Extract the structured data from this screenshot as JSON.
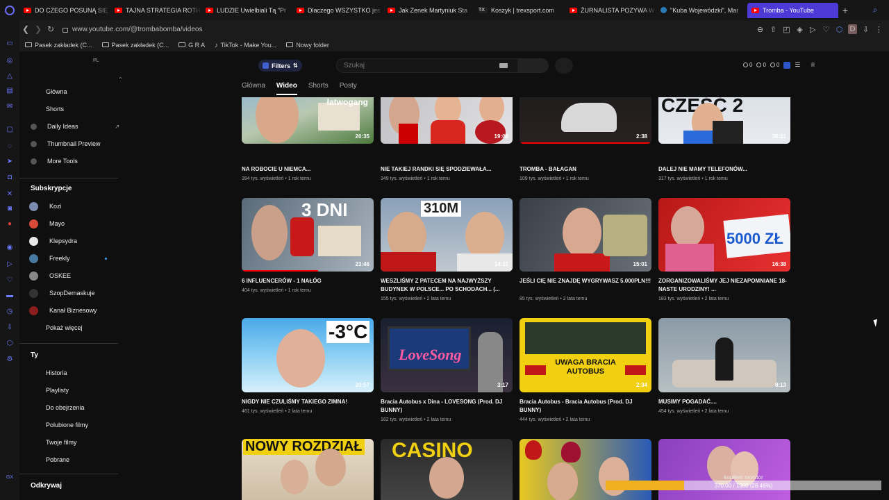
{
  "browser": {
    "tabs": [
      {
        "label": "DO CZEGO POSUNĄ SIĘ",
        "icon": "youtube-icon"
      },
      {
        "label": "TAJNA STRATEGIA ROTH",
        "icon": "youtube-icon"
      },
      {
        "label": "LUDZIE Uwielbiali Tą \"Pr",
        "icon": "youtube-icon"
      },
      {
        "label": "Dlaczego WSZYSTKO jes",
        "icon": "youtube-icon"
      },
      {
        "label": "Jak Zenek Martyniuk Sta",
        "icon": "youtube-icon"
      },
      {
        "label": "Koszyk | trexsport.com",
        "icon": "trexsport-icon"
      },
      {
        "label": "ŻURNALISTA POZYWA W",
        "icon": "youtube-icon"
      },
      {
        "label": "\"Kuba Wojewódzki\", Mar",
        "icon": "globe-icon"
      },
      {
        "label": "Tromba - YouTube",
        "icon": "youtube-icon"
      }
    ],
    "url": "www.youtube.com/@trombabomba/videos",
    "profile_initial": "D",
    "bookmarks": [
      "Pasek zakładek (C...",
      "Pasek zakładek (C...",
      "G R A",
      "TikTok - Make You...",
      "Nowy folder"
    ]
  },
  "sidebar": {
    "locale": "PL",
    "main": [
      "Główna",
      "Shorts",
      "Daily Ideas",
      "Thumbnail Preview",
      "More Tools"
    ],
    "subs_heading": "Subskrypcje",
    "subs": [
      "Kozi",
      "Mayo",
      "Klepsydra",
      "Freekly",
      "OSKEE",
      "SzopDemaskuje",
      "Kanał Biznesowy"
    ],
    "show_more": "Pokaż więcej",
    "you_heading": "Ty",
    "you": [
      "Historia",
      "Playlisty",
      "Do obejrzenia",
      "Polubione filmy",
      "Twoje filmy",
      "Pobrane"
    ],
    "explore_heading": "Odkrywaj"
  },
  "header": {
    "filters_label": "Filters",
    "search_placeholder": "Szukaj",
    "counters": [
      "0",
      "0",
      "0"
    ]
  },
  "channel_tabs": [
    "Główna",
    "Wideo",
    "Shorts",
    "Posty"
  ],
  "videos": [
    {
      "title": "NA ROBOCIE U NIEMCA...",
      "meta": "394 tys. wyświetleń • 1 rok temu",
      "duration": "20:35",
      "thumb_text": "łatwogang"
    },
    {
      "title": "NIE TAKIEJ RANDKI SIĘ SPODZIEWAŁA...",
      "meta": "349 tys. wyświetleń • 1 rok temu",
      "duration": "19:08",
      "thumb_text": ""
    },
    {
      "title": "TROMBA - BAŁAGAN",
      "meta": "109 tys. wyświetleń • 1 rok temu",
      "duration": "2:38",
      "thumb_text": ""
    },
    {
      "title": "DALEJ NIE MAMY TELEFONÓW...",
      "meta": "317 tys. wyświetleń • 1 rok temu",
      "duration": "36:21",
      "thumb_text": "CZĘŚĆ 2"
    },
    {
      "title": "6 INFLUENCERÓW - 1 NAŁÓG",
      "meta": "404 tys. wyświetleń • 1 rok temu",
      "duration": "23:46",
      "thumb_text": "3 DNI"
    },
    {
      "title": "WESZLIŚMY Z PATECEM NA NAJWYŻSZY BUDYNEK W POLSCE... PO SCHODACH... (...",
      "meta": "155 tys. wyświetleń • 2 lata temu",
      "duration": "14:11",
      "thumb_text": "310M"
    },
    {
      "title": "JEŚLI CIĘ NIE ZNAJDĘ WYGRYWASZ 5.000PLN!!!",
      "meta": "85 tys. wyświetleń • 2 lata temu",
      "duration": "15:01",
      "thumb_text": ""
    },
    {
      "title": "ZORGANIZOWALIŚMY JEJ NIEZAPOMNIANE 18-NASTE URODZINY! ...",
      "meta": "183 tys. wyświetleń • 2 lata temu",
      "duration": "16:38",
      "thumb_text": "5000 ZŁ"
    },
    {
      "title": "NIGDY NIE CZULIŚMY TAKIEGO ZIMNA!",
      "meta": "461 tys. wyświetleń • 2 lata temu",
      "duration": "20:57",
      "thumb_text": "-3°C"
    },
    {
      "title": "Bracia Autobus x Dina - LOVESONG (Prod. DJ BUNNY)",
      "meta": "162 tys. wyświetleń • 2 lata temu",
      "duration": "3:17",
      "thumb_text": "LoveSong"
    },
    {
      "title": "Bracia Autobus - Bracia Autobus (Prod. DJ BUNNY)",
      "meta": "444 tys. wyświetleń • 2 lata temu",
      "duration": "2:34",
      "thumb_text": "UWAGA BRACIA AUTOBUS"
    },
    {
      "title": "MUSIMY POGADAĆ....",
      "meta": "454 tys. wyświetleń • 2 lata temu",
      "duration": "8:13",
      "thumb_text": ""
    },
    {
      "title": "",
      "meta": "",
      "duration": "",
      "thumb_text": "NOWY ROZDZIAŁ"
    },
    {
      "title": "",
      "meta": "",
      "duration": "",
      "thumb_text": "CASINO"
    },
    {
      "title": "",
      "meta": "",
      "duration": "",
      "thumb_text": ""
    },
    {
      "title": "",
      "meta": "",
      "duration": "",
      "thumb_text": ""
    }
  ],
  "overlay": {
    "label": "kupiłem monitor",
    "progress": "370.00 / 1300 (28.46%)",
    "progress_fraction": 0.2846,
    "color": "#f0b020"
  },
  "colors": {
    "accent": "#4b3ad6",
    "yt_red": "#ff0000",
    "background": "#0f0f0f"
  }
}
